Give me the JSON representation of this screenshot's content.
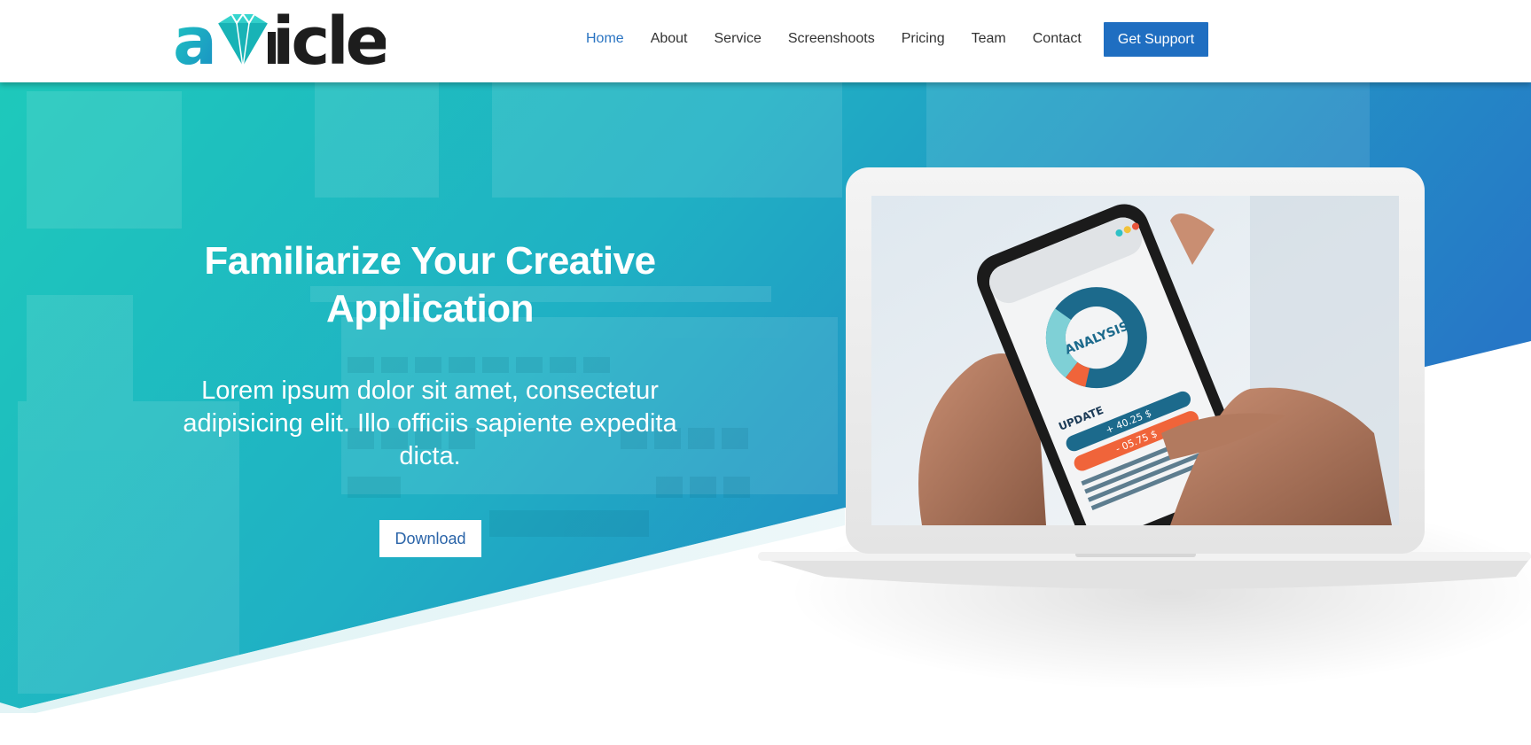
{
  "brand": {
    "logo_text": "awicle",
    "logo_text_start": "a",
    "logo_text_end": "icle",
    "gem_color": "#1cc7c1",
    "dark_color": "#1d1d1d"
  },
  "nav": {
    "items": [
      {
        "label": "Home",
        "active": true
      },
      {
        "label": "About",
        "active": false
      },
      {
        "label": "Service",
        "active": false
      },
      {
        "label": "Screenshoots",
        "active": false
      },
      {
        "label": "Pricing",
        "active": false
      },
      {
        "label": "Team",
        "active": false
      },
      {
        "label": "Contact",
        "active": false
      }
    ],
    "cta_label": "Get Support",
    "active_color": "#2a74c2",
    "cta_color": "#1f6ec1"
  },
  "hero": {
    "title": "Familiarize Your Creative Application",
    "description": "Lorem ipsum dolor sit amet, consectetur adipisicing elit. Illo officiis sapiente expedita dicta.",
    "button_label": "Download",
    "gradient_start": "#1ec9bb",
    "gradient_end": "#2677c6"
  },
  "phone_screen": {
    "chart_label": "ANALYSIS",
    "update_label": "UPDATE",
    "positive_value": "+ 40.25 $",
    "negative_value": "- 05.75 $"
  }
}
